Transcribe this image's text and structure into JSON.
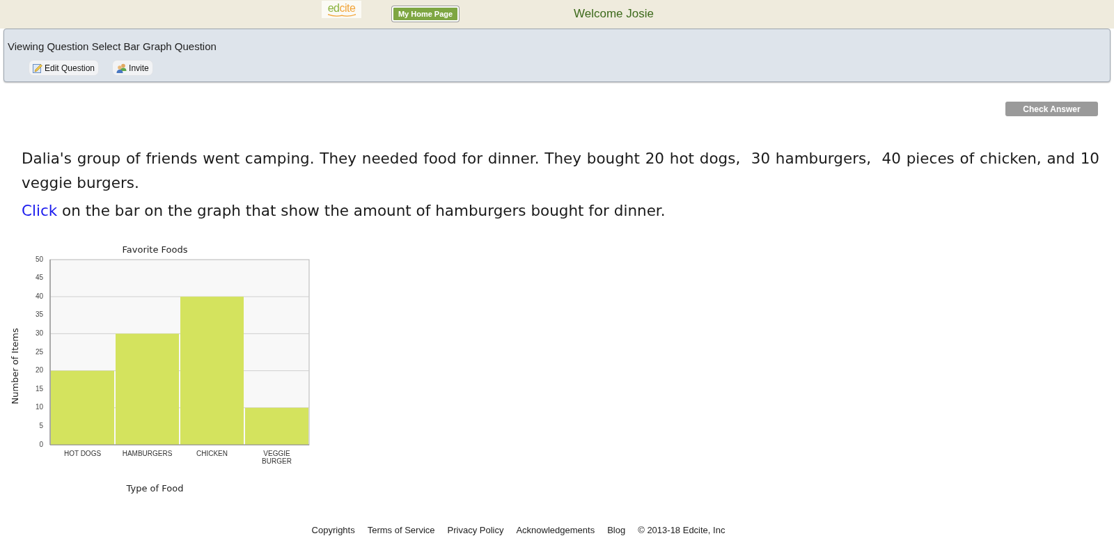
{
  "header": {
    "logo": {
      "parts": [
        {
          "text": "ed",
          "color": "#8bb33f"
        },
        {
          "text": "cite",
          "color": "#f2a53a"
        }
      ]
    },
    "home_button": "My Home Page",
    "welcome": "Welcome Josie"
  },
  "question_panel": {
    "title": "Viewing Question Select Bar Graph Question",
    "actions": [
      {
        "kind": "edit",
        "label": "Edit Question"
      },
      {
        "kind": "invite",
        "label": "Invite"
      }
    ]
  },
  "check_answer": {
    "label": "Check Answer",
    "disabled": true
  },
  "question": {
    "paragraph": "Dalia's group of friends went camping. They needed food for dinner. They bought 20 hot dogs,  30 hamburgers,  40 pieces of chicken, and 10 veggie burgers.",
    "instruction": {
      "link": "Click",
      "text": "on the bar on the graph that show the amount of hamburgers bought for dinner."
    }
  },
  "chart": {
    "chart_data": {
      "type": "bar",
      "title": "Favorite Foods",
      "xlabel": "Type of Food",
      "ylabel": "Number of Items",
      "categories": [
        "HOT DOGS",
        "HAMBURGERS",
        "CHICKEN",
        "VEGGIE BURGER"
      ],
      "values": [
        20,
        30,
        40,
        10
      ],
      "ylim": [
        0,
        50
      ],
      "yticks": [
        0,
        5,
        10,
        15,
        20,
        25,
        30,
        35,
        40,
        45,
        50
      ],
      "grid": true
    }
  },
  "footer": {
    "links": [
      "Copyrights",
      "Terms of Service",
      "Privacy Policy",
      "Acknowledgements",
      "Blog"
    ],
    "copyright": "© 2013-18 Edcite, Inc"
  }
}
